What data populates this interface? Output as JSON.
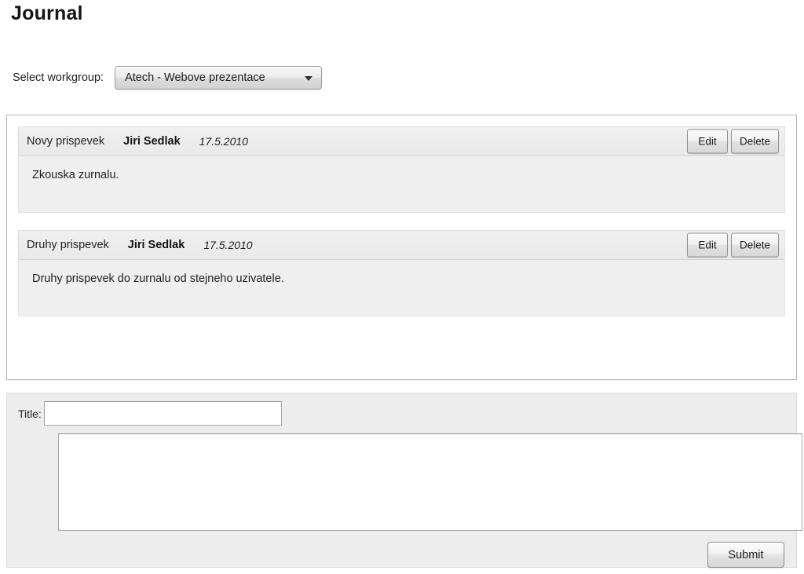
{
  "page": {
    "title": "Journal"
  },
  "workgroup": {
    "label": "Select workgroup:",
    "selected": "Atech - Webove prezentace",
    "options": [
      "Atech - Webove prezentace"
    ],
    "arrow_icon": "chevron-down-icon"
  },
  "entries": [
    {
      "title": "Novy prispevek",
      "author": "Jiri Sedlak",
      "date": "17.5.2010",
      "body": "Zkouska zurnalu.",
      "edit_label": "Edit",
      "delete_label": "Delete"
    },
    {
      "title": "Druhy prispevek",
      "author": "Jiri Sedlak",
      "date": "17.5.2010",
      "body": "Druhy prispevek do zurnalu od stejneho uzivatele.",
      "edit_label": "Edit",
      "delete_label": "Delete"
    }
  ],
  "form": {
    "title_label": "Title:",
    "title_value": "",
    "title_placeholder": "",
    "body_value": "",
    "body_placeholder": "",
    "submit_label": "Submit"
  },
  "colors": {
    "page_background": "#ffffff",
    "panel_border": "#b4b4b4",
    "entry_header_bg": "#ededed",
    "entry_body_bg": "#efefef",
    "form_bg": "#ededed",
    "text": "#1f1f1f"
  }
}
